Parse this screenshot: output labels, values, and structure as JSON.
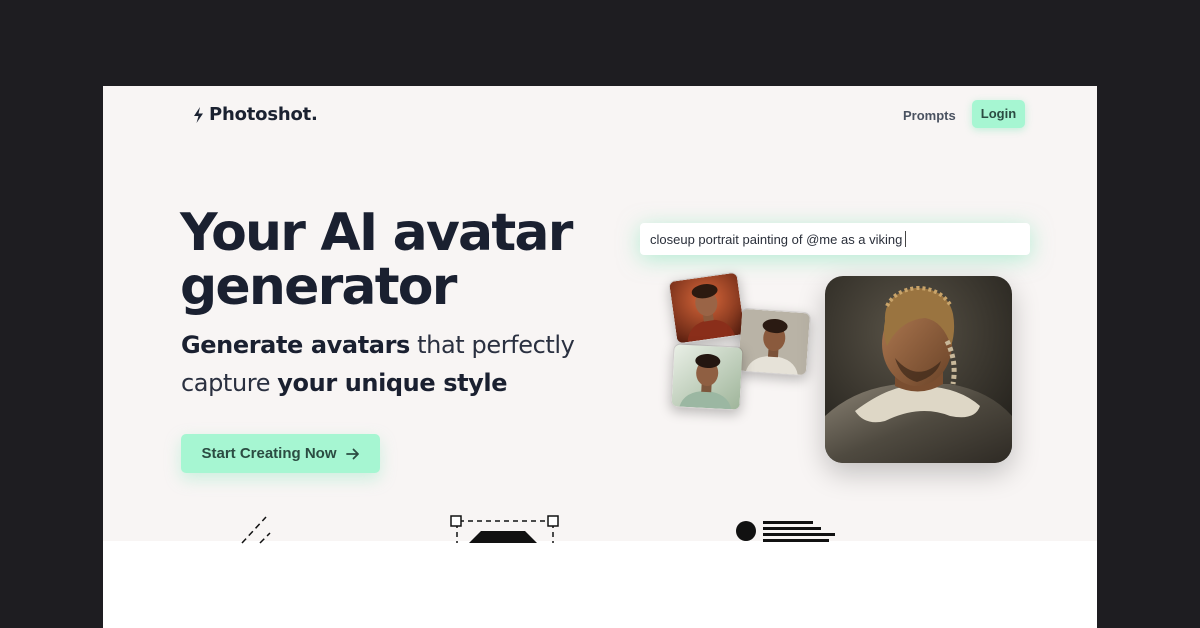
{
  "header": {
    "logo_text": "Photoshot.",
    "logo_icon": "lightning-bolt-icon",
    "nav": {
      "prompts_label": "Prompts",
      "login_label": "Login"
    }
  },
  "hero": {
    "headline": "Your AI avatar generator",
    "subline_part1": "Generate avatars",
    "subline_part2": " that perfectly capture ",
    "subline_part3": "your unique style",
    "cta_label": "Start Creating Now",
    "cta_icon": "arrow-right-icon"
  },
  "demo": {
    "prompt_text": "closeup portrait painting of @me as a viking",
    "input_images": [
      "input-photo-1",
      "input-photo-2",
      "input-photo-3"
    ],
    "result_image": "generated-viking-portrait"
  },
  "features": {
    "icons": [
      "pen-icon",
      "selection-icon",
      "profile-icon"
    ]
  },
  "colors": {
    "accent": "#a6f6d2",
    "accent_text": "#2b4c42",
    "heading": "#1a2030",
    "page_background": "#f8f5f4",
    "outer_background": "#1e1d21"
  }
}
